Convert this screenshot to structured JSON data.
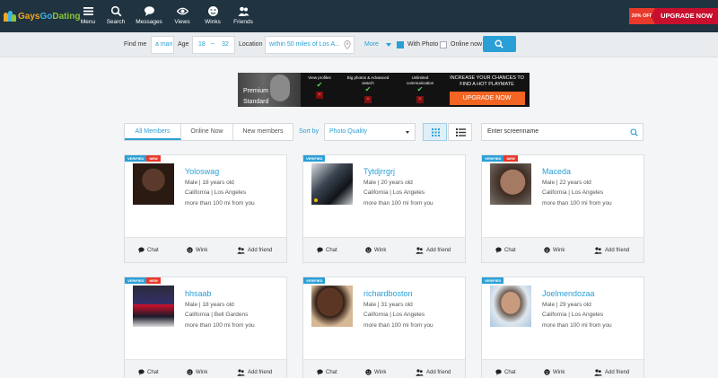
{
  "brand": {
    "part1": "Gays",
    "part2": "Go",
    "part3": "Dating"
  },
  "nav": [
    {
      "label": "Menu",
      "icon": "menu-icon"
    },
    {
      "label": "Search",
      "icon": "search-icon"
    },
    {
      "label": "Messages",
      "icon": "chat-bubble-icon"
    },
    {
      "label": "Views",
      "icon": "eye-icon"
    },
    {
      "label": "Winks",
      "icon": "wink-face-icon"
    },
    {
      "label": "Friends",
      "icon": "friends-icon"
    }
  ],
  "promo": {
    "discount": "30% OFF",
    "upgrade": "UPGRADE NOW"
  },
  "search": {
    "find_me_label": "Find me",
    "find_me_value": "a man",
    "age_label": "Age",
    "age_min": "18",
    "age_sep": "~",
    "age_max": "32",
    "location_label": "Location",
    "location_value": "within 50 miles of Los A...",
    "more_label": "More",
    "with_photo_label": "With Photo",
    "with_photo_checked": true,
    "online_now_label": "Online now",
    "online_now_checked": false
  },
  "banner": {
    "tier_line1": "Premium",
    "tier_line2": "Standard",
    "features": [
      {
        "label": "View profiles"
      },
      {
        "label": "Big photos & Advanced search"
      },
      {
        "label": "Unlimited communication"
      }
    ],
    "pitch": "INCREASE YOUR CHANCES TO FIND A HOT PLAYMATE",
    "button": "UPGRADE NOW"
  },
  "filters": {
    "tabs": [
      "All Members",
      "Online Now",
      "New members"
    ],
    "active_tab": 0,
    "sort_label": "Sort by",
    "sort_value": "Photo Quality",
    "screenname_placeholder": "Enter screenname"
  },
  "members": [
    {
      "name": "Yoloswag",
      "details": "Male | 18 years old",
      "location": "California | Los Angeles",
      "distance": "more than 100 mi from you",
      "verified": true,
      "new": true,
      "online": false
    },
    {
      "name": "Tytdjrrgrj",
      "details": "Male | 20 years old",
      "location": "California | Los Angeles",
      "distance": "more than 100 mi from you",
      "verified": true,
      "new": false,
      "online": true
    },
    {
      "name": "Maceda",
      "details": "Male | 22 years old",
      "location": "California | Los Angeles",
      "distance": "more than 100 mi from you",
      "verified": true,
      "new": true,
      "online": false
    },
    {
      "name": "hhsaab",
      "details": "Male | 18 years old",
      "location": "California | Bell Gardens",
      "distance": "more than 100 mi from you",
      "verified": true,
      "new": true,
      "online": false
    },
    {
      "name": "richardboston",
      "details": "Male | 31 years old",
      "location": "California | Los Angeles",
      "distance": "more than 100 mi from you",
      "verified": true,
      "new": false,
      "online": false
    },
    {
      "name": "Joelmendozaa",
      "details": "Male | 29 years old",
      "location": "California | Los Angeles",
      "distance": "more than 100 mi from you",
      "verified": true,
      "new": false,
      "online": false
    }
  ],
  "badges": {
    "verified": "VERIFIED",
    "new": "NEW"
  },
  "actions": {
    "chat": "Chat",
    "wink": "Wink",
    "add_friend": "Add friend"
  }
}
